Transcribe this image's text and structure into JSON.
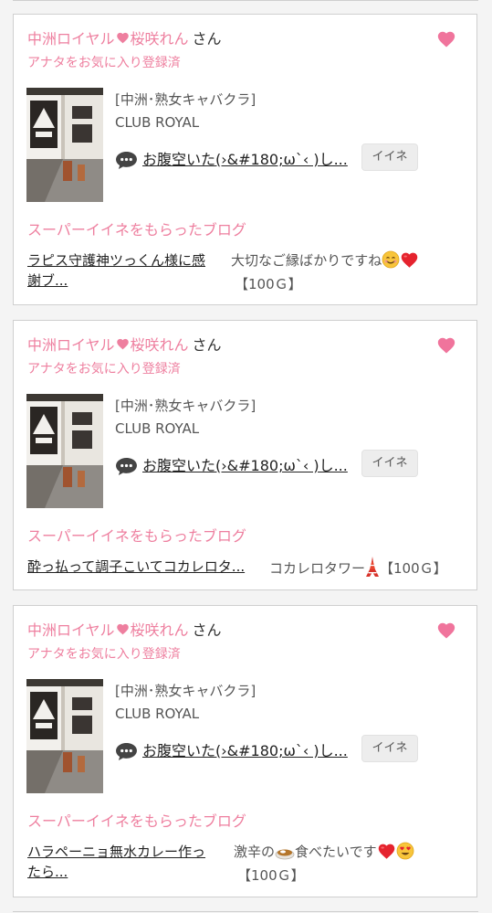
{
  "cards": [
    {
      "shop_name": "中洲ロイヤル",
      "name_suffix": "桜咲れん",
      "honorific": "さん",
      "fav_status": "アナタをお気に入り登録済",
      "category": "[中洲･熟女キャバクラ]",
      "club": "CLUB ROYAL",
      "post_title": "お腹空いた(›&#180;ω`‹ )し...",
      "iine_label": "イイネ",
      "section_title": "スーパーイイネをもらったブログ",
      "blog_link_line1": "ラピス守護神ツっくん様に感",
      "blog_link_line2": "謝ブ...",
      "blog_comment_text": "大切なご縁ばかりですね",
      "blog_comment_reward": "【100Ｇ】"
    },
    {
      "shop_name": "中洲ロイヤル",
      "name_suffix": "桜咲れん",
      "honorific": "さん",
      "fav_status": "アナタをお気に入り登録済",
      "category": "[中洲･熟女キャバクラ]",
      "club": "CLUB ROYAL",
      "post_title": "お腹空いた(›&#180;ω`‹ )し...",
      "iine_label": "イイネ",
      "section_title": "スーパーイイネをもらったブログ",
      "blog_link_line1": "酔っ払って調子こいてコカレロタ...",
      "blog_comment_text": "コカレロタワー",
      "blog_comment_reward": "【100Ｇ】"
    },
    {
      "shop_name": "中洲ロイヤル",
      "name_suffix": "桜咲れん",
      "honorific": "さん",
      "fav_status": "アナタをお気に入り登録済",
      "category": "[中洲･熟女キャバクラ]",
      "club": "CLUB ROYAL",
      "post_title": "お腹空いた(›&#180;ω`‹ )し...",
      "iine_label": "イイネ",
      "section_title": "スーパーイイネをもらったブログ",
      "blog_link_line1": "ハラペーニョ無水カレー作っ",
      "blog_link_line2": "たら...",
      "blog_comment_text_a": "激辛の",
      "blog_comment_text_b": "食べたいです",
      "blog_comment_reward": "【100Ｇ】"
    }
  ],
  "colors": {
    "accent_pink": "#ee7f9f",
    "heart_pink": "#f0749c"
  },
  "icons": [
    "heart-icon",
    "comment-bubble-icon",
    "smile-emoji",
    "red-heart-emoji",
    "tokyo-tower-emoji",
    "curry-emoji",
    "heart-eyes-emoji"
  ]
}
